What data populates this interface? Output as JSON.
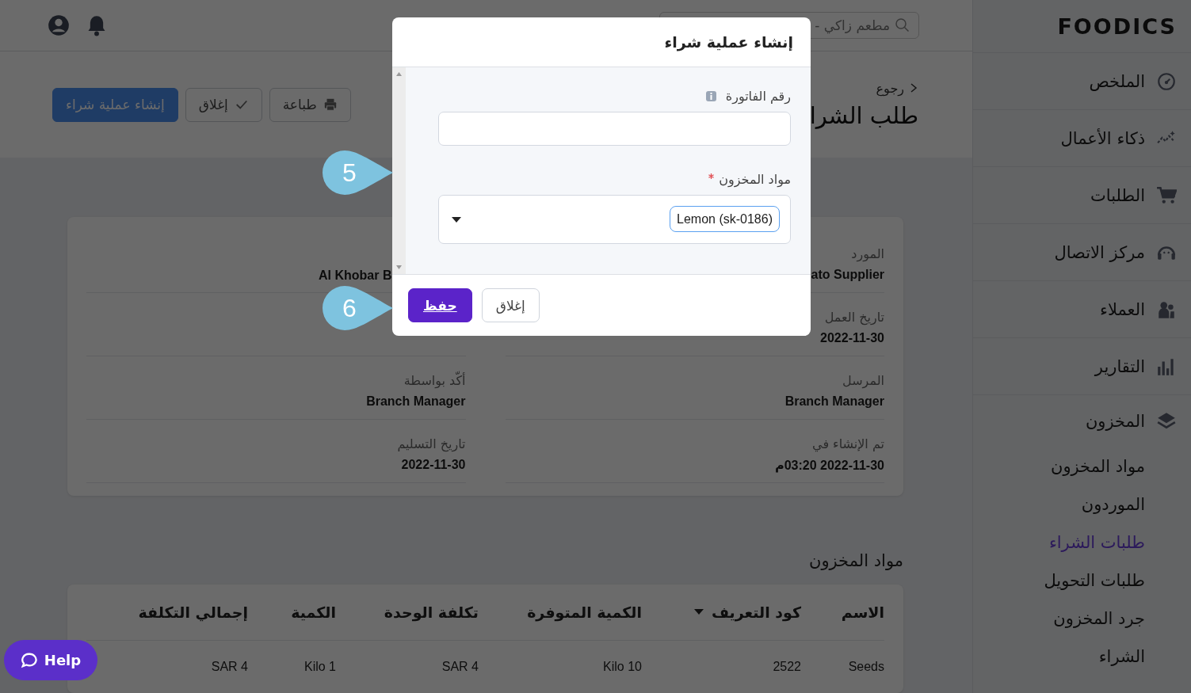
{
  "sidebar": {
    "logo": "FOODICS",
    "items": [
      {
        "label": "الملخص"
      },
      {
        "label": "ذكاء الأعمال"
      },
      {
        "label": "الطلبات"
      },
      {
        "label": "مركز الاتصال"
      },
      {
        "label": "العملاء"
      },
      {
        "label": "التقارير"
      }
    ],
    "section": {
      "label": "المخزون",
      "expanded": true,
      "children": [
        {
          "label": "مواد المخزون",
          "selected": false
        },
        {
          "label": "الموردون",
          "selected": false
        },
        {
          "label": "طلبات الشراء",
          "selected": true
        },
        {
          "label": "طلبات التحويل",
          "selected": false
        },
        {
          "label": "جرد المخزون",
          "selected": false
        },
        {
          "label": "الشراء",
          "selected": false
        }
      ]
    }
  },
  "topbar": {
    "search": {
      "value": "مطعم زاكي -"
    }
  },
  "header": {
    "back": "رجوع",
    "title": "طلب الشرا",
    "buttons": [
      {
        "label": "طباعة",
        "kind": "print"
      },
      {
        "label": "إغلاق",
        "kind": "close"
      },
      {
        "label": "إنشاء عملية شراء",
        "kind": "primary"
      }
    ]
  },
  "details": {
    "rows": [
      [
        {
          "label": "المورد",
          "value": "ato Supplier"
        },
        {
          "value": "Al Khobar B",
          "clipped": true
        }
      ],
      [
        {
          "label": "تاريخ العمل",
          "value": "2022-11-30"
        },
        null
      ],
      [
        {
          "label": "المرسل",
          "value": "Branch Manager"
        },
        {
          "label": "أكّد بواسطة",
          "value": "Branch Manager"
        }
      ],
      [
        {
          "label": "تم الإنشاء في",
          "value": "2022-11-30 03:20م"
        },
        {
          "label": "تاريخ التسليم",
          "value": "2022-11-30"
        }
      ]
    ]
  },
  "inventory": {
    "title": "مواد المخزون",
    "columns": [
      {
        "label": "الاسم",
        "sorted": false
      },
      {
        "label": "كود التعريف",
        "sorted": true
      },
      {
        "label": "الكمية المتوفرة",
        "sorted": false
      },
      {
        "label": "تكلفة الوحدة",
        "sorted": false
      },
      {
        "label": "الكمية",
        "sorted": false
      },
      {
        "label": "إجمالي التكلفة",
        "sorted": false
      }
    ],
    "rows": [
      [
        "Seeds",
        "2522",
        "10 Kilo",
        "SAR 4",
        "1 Kilo",
        "SAR 4"
      ]
    ]
  },
  "help": {
    "label": "Help"
  },
  "modal": {
    "title": "إنشاء عملية شراء",
    "fields": [
      {
        "kind": "text",
        "label": "رقم الفاتورة",
        "info": true,
        "required": false
      },
      {
        "kind": "multiselect",
        "label": "مواد المخزون",
        "info": false,
        "required": true,
        "tags": [
          "Lemon (sk-0186)"
        ]
      }
    ],
    "buttons": [
      {
        "label": "إغلاق",
        "kind": "secondary"
      },
      {
        "label": "حفظ",
        "kind": "primary"
      }
    ]
  },
  "callouts": [
    {
      "number": "5"
    },
    {
      "number": "6"
    }
  ]
}
